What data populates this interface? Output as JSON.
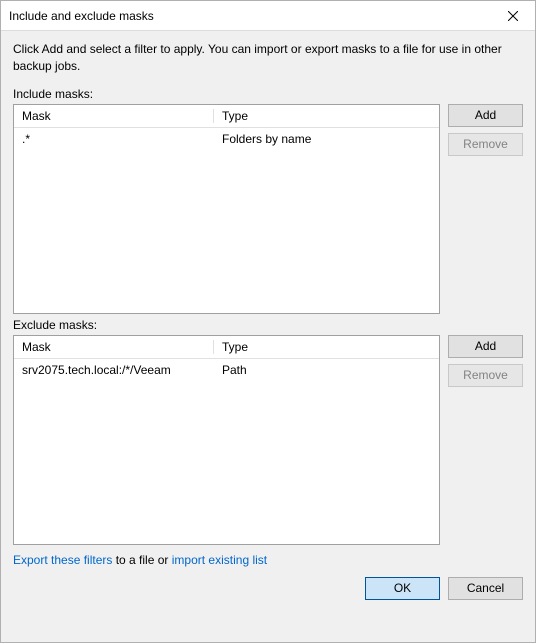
{
  "title": "Include and exclude masks",
  "description": "Click Add and select a filter to apply. You can import or export masks to a file for use in other backup jobs.",
  "includeSection": {
    "label": "Include masks:",
    "headers": {
      "mask": "Mask",
      "type": "Type"
    },
    "rows": [
      {
        "mask": ".*",
        "type": "Folders by name"
      }
    ],
    "addLabel": "Add",
    "removeLabel": "Remove"
  },
  "excludeSection": {
    "label": "Exclude masks:",
    "headers": {
      "mask": "Mask",
      "type": "Type"
    },
    "rows": [
      {
        "mask": "srv2075.tech.local:/*/Veeam",
        "type": "Path"
      }
    ],
    "addLabel": "Add",
    "removeLabel": "Remove"
  },
  "links": {
    "exportText": "Export these filters",
    "middleText": " to a file or ",
    "importText": "import existing list"
  },
  "footer": {
    "ok": "OK",
    "cancel": "Cancel"
  }
}
